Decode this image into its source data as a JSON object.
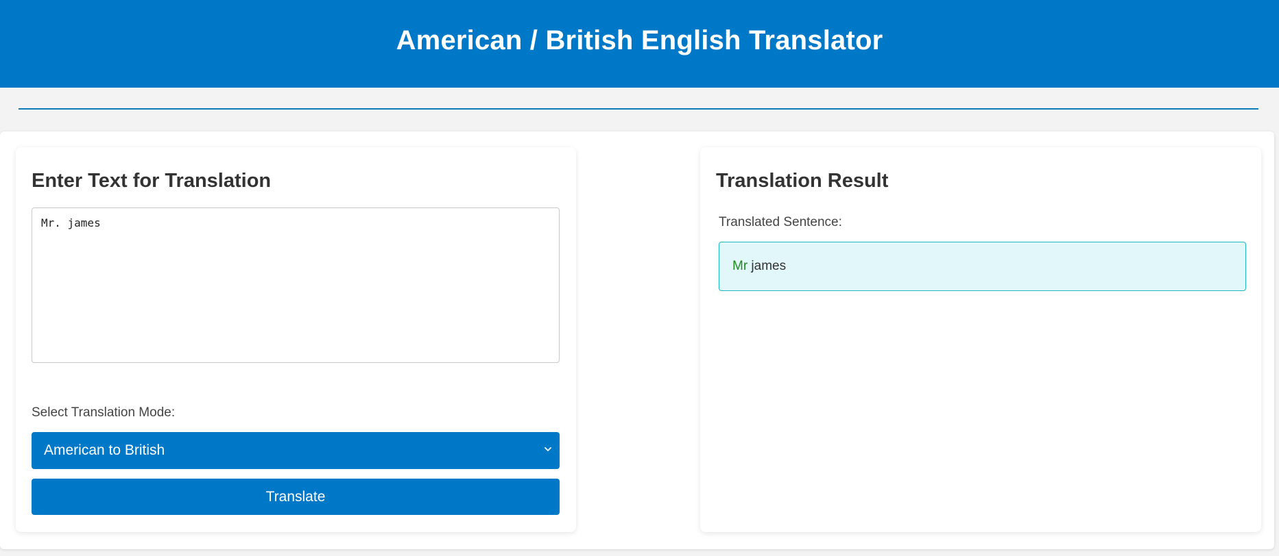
{
  "header": {
    "title": "American / British English Translator"
  },
  "input_card": {
    "title": "Enter Text for Translation",
    "text_value": "Mr. james",
    "mode_label": "Select Translation Mode:",
    "mode_selected": "American to British",
    "translate_label": "Translate"
  },
  "result_card": {
    "title": "Translation Result",
    "label": "Translated Sentence:",
    "highlighted": "Mr",
    "rest": " james"
  },
  "colors": {
    "brand": "#0078c8",
    "highlight": "#1f8a1f",
    "result_bg": "#e2f7fa",
    "result_border": "#1cb8c4"
  },
  "icons": {
    "select_arrow": "chevron-down-icon"
  }
}
